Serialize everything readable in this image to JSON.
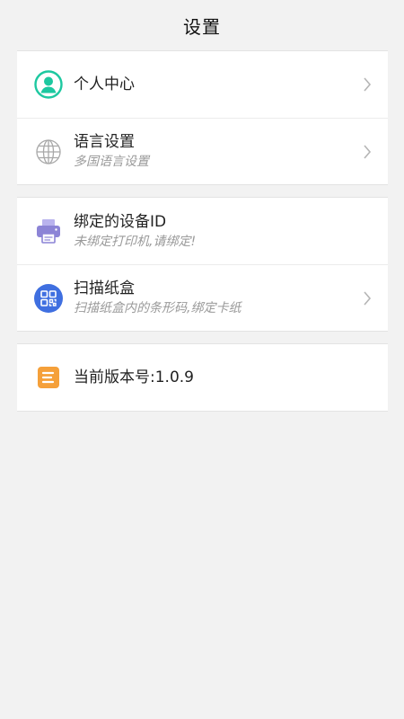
{
  "header": {
    "title": "设置"
  },
  "groups": [
    {
      "items": [
        {
          "icon": "user-icon",
          "label": "个人中心",
          "sub": ""
        },
        {
          "icon": "globe-icon",
          "label": "语言设置",
          "sub": "多国语言设置"
        }
      ]
    },
    {
      "items": [
        {
          "icon": "printer-icon",
          "label": "绑定的设备ID",
          "sub": "未绑定打印机,请绑定!"
        },
        {
          "icon": "qr-code-icon",
          "label": "扫描纸盒",
          "sub": "扫描纸盒内的条形码,绑定卡纸"
        }
      ]
    },
    {
      "items": [
        {
          "icon": "document-icon",
          "label": "当前版本号:1.0.9",
          "sub": ""
        }
      ]
    }
  ],
  "colors": {
    "user_icon": "#1dc8a0",
    "printer_icon": "#8c84d6",
    "qr_icon": "#3f6fe0",
    "document_icon": "#f5a03a",
    "chevron": "#b5b5b5"
  }
}
